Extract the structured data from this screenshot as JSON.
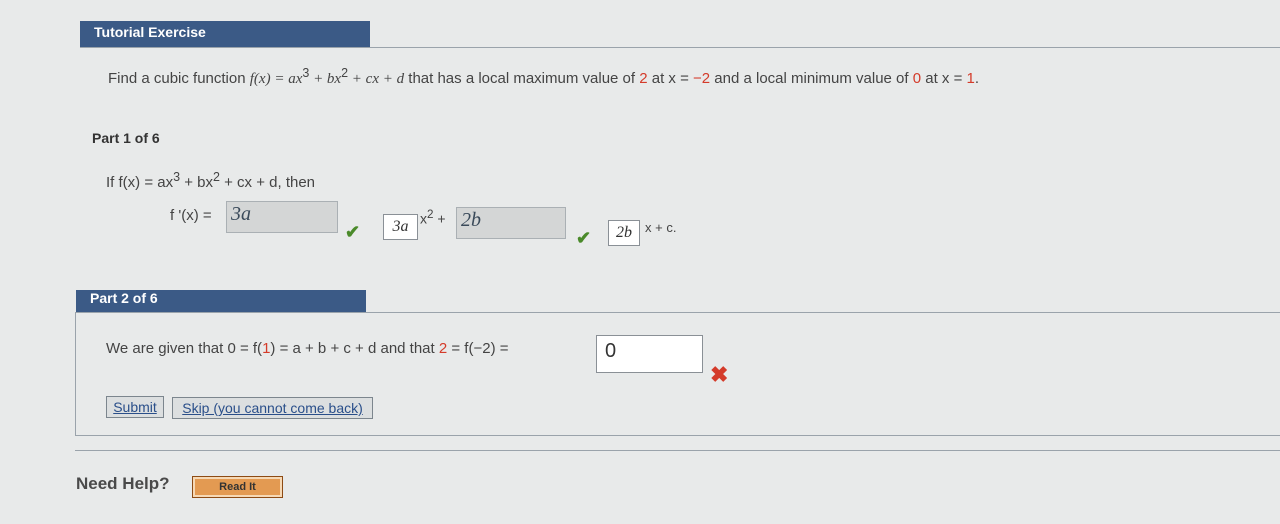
{
  "tutorial": {
    "header": "Tutorial Exercise"
  },
  "problem": {
    "p1": "Find a cubic function ",
    "fx": "f(x) = ax",
    "e1": "3",
    "p2": " + bx",
    "e2": "2",
    "p3": " + cx + d",
    "p4": " that has a local maximum value of ",
    "v1": "2",
    "p5": " at x = ",
    "v2": "−2",
    "p6": " and a local minimum value of ",
    "v3": "0",
    "p7": " at x = ",
    "v4": "1",
    "p8": "."
  },
  "part1": {
    "label": "Part 1 of 6",
    "if": "If  f(x) = ax",
    "e1": "3",
    "mid": " + bx",
    "e2": "2",
    "tail": " + cx + d,  then",
    "fprime": "f '(x) = ",
    "ans1": "3a",
    "box1": "3a",
    "x2": "x",
    "x2exp": "2",
    "plus": " + ",
    "ans2": "2b",
    "box2": "2b",
    "xc": "x + c."
  },
  "part2": {
    "header": "Part 2 of 6",
    "t1": "We are given that  0 = f(",
    "one": "1",
    "t2": ") = a + b + c + d  and that  ",
    "two": "2",
    "t3": " = f(−2) = ",
    "input_value": "0",
    "submit": "Submit",
    "skip": "Skip (you cannot come back)"
  },
  "help": {
    "label": "Need Help?",
    "read": "Read It"
  },
  "icons": {
    "check": "check-icon",
    "wrong": "x-icon"
  },
  "colors": {
    "header_bg": "#3b5a86",
    "red_value": "#d43b2a",
    "check": "#4a8a2a"
  }
}
